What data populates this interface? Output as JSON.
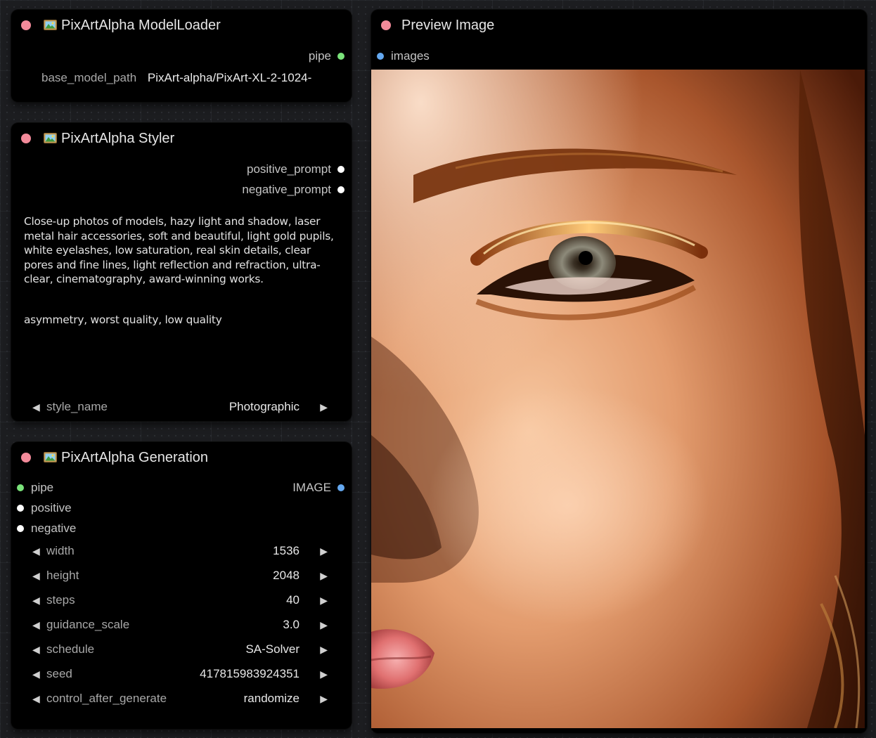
{
  "nodes": {
    "model_loader": {
      "title": "PixArtAlpha ModelLoader",
      "output_pipe": "pipe",
      "base_model_label": "base_model_path",
      "base_model_value": "PixArt-alpha/PixArt-XL-2-1024-"
    },
    "styler": {
      "title": "PixArtAlpha Styler",
      "output_positive": "positive_prompt",
      "output_negative": "negative_prompt",
      "positive_text": "Close-up photos of models, hazy light and shadow, laser metal hair accessories, soft and beautiful, light gold pupils, white eyelashes, low saturation, real skin details, clear pores and fine lines, light reflection and refraction, ultra-clear, cinematography, award-winning works.",
      "negative_text": "asymmetry, worst quality, low quality",
      "style_name_label": "style_name",
      "style_name_value": "Photographic"
    },
    "generation": {
      "title": "PixArtAlpha Generation",
      "input_pipe": "pipe",
      "input_positive": "positive",
      "input_negative": "negative",
      "output_image": "IMAGE",
      "widgets": [
        {
          "label": "width",
          "value": "1536"
        },
        {
          "label": "height",
          "value": "2048"
        },
        {
          "label": "steps",
          "value": "40"
        },
        {
          "label": "guidance_scale",
          "value": "3.0"
        },
        {
          "label": "schedule",
          "value": "SA-Solver"
        },
        {
          "label": "seed",
          "value": "417815983924351"
        },
        {
          "label": "control_after_generate",
          "value": "randomize"
        }
      ]
    },
    "preview": {
      "title": "Preview Image",
      "input_images": "images"
    }
  },
  "colors": {
    "node_bg": "#000000",
    "canvas_bg": "#1c1d20",
    "collapse_dot": "#f38a9a",
    "pipe_slot": "#7ae37a",
    "image_slot": "#64a8f0",
    "text_slot": "#ffffff"
  },
  "icons": {
    "collapse": "pink-dot-icon",
    "node_emoji": "framed-picture-icon",
    "widget_left": "triangle-left-icon",
    "widget_right": "triangle-right-icon"
  }
}
